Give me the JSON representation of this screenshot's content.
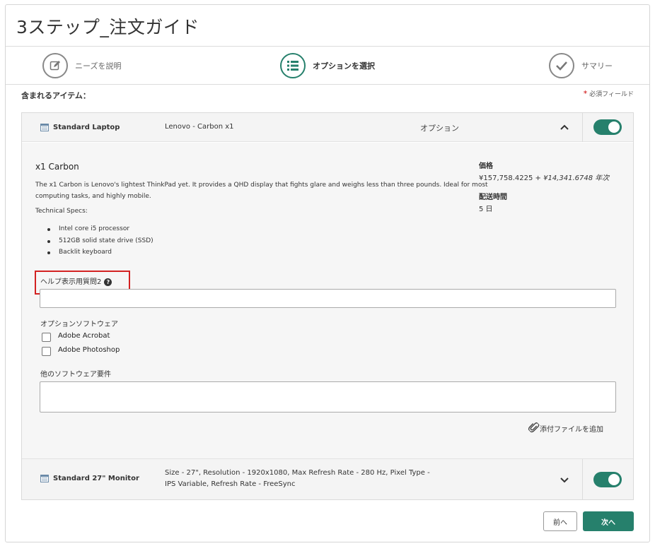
{
  "page": {
    "title": "3ステップ_注文ガイド"
  },
  "steps": [
    {
      "label": "ニーズを説明",
      "icon": "edit-icon",
      "state": "completed"
    },
    {
      "label": "オプションを選択",
      "icon": "list-icon",
      "state": "active"
    },
    {
      "label": "サマリー",
      "icon": "check-icon",
      "state": "pending"
    }
  ],
  "included_items_label": "含まれるアイテム：",
  "required_field_note": "必須フィールド",
  "required_star": "*",
  "items": [
    {
      "name": "Standard Laptop",
      "description": "Lenovo - Carbon x1",
      "option_label": "オプション",
      "expanded": true,
      "enabled": true
    },
    {
      "name": "Standard 27\" Monitor",
      "description_line1": "Size - 27\", Resolution - 1920x1080, Max Refresh Rate - 280 Hz, Pixel Type -",
      "description_line2": "IPS Variable, Refresh Rate - FreeSync",
      "expanded": false,
      "enabled": true
    }
  ],
  "detail": {
    "product_title": "x1 Carbon",
    "product_text_line1": "The x1 Carbon is Lenovo's lightest ThinkPad yet. It provides a QHD display that fights glare and weighs less than three pounds. Ideal for most",
    "product_text_line2": "computing tasks, and highly mobile.",
    "specs_heading": "Technical Specs:",
    "specs": [
      "Intel core i5 processor",
      "512GB solid state drive (SSD)",
      "Backlit keyboard"
    ],
    "price_label": "価格",
    "price_value": "¥157,758.4225",
    "price_recurring": "+ ¥14,341.6748 年次",
    "delivery_label": "配送時間",
    "delivery_value": "5 日"
  },
  "form": {
    "help_question_label": "ヘルプ表示用質問2",
    "help_question_value": "",
    "optional_software_label": "オプションソフトウェア",
    "software_options": [
      {
        "label": "Adobe Acrobat",
        "checked": false
      },
      {
        "label": "Adobe Photoshop",
        "checked": false
      }
    ],
    "other_requirements_label": "他のソフトウェア要件",
    "other_requirements_value": "",
    "attach_label": "添付ファイルを追加"
  },
  "buttons": {
    "prev": "前へ",
    "next": "次へ"
  },
  "colors": {
    "accent": "#26806c",
    "highlight": "#d32222"
  }
}
